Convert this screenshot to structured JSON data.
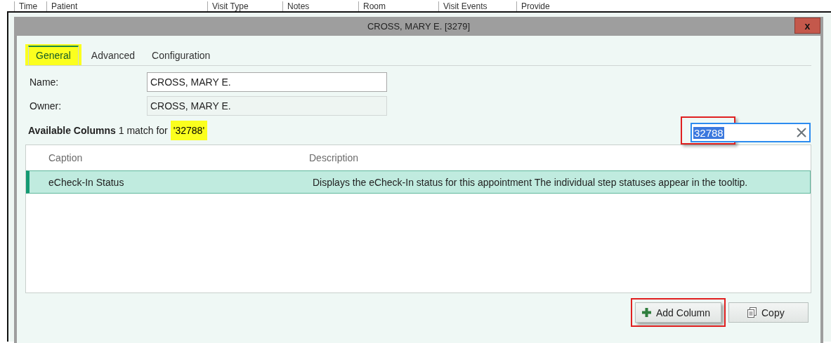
{
  "background_table": {
    "columns": [
      "Time",
      "Patient",
      "Visit Type",
      "Notes",
      "Room",
      "Visit Events",
      "Provide"
    ]
  },
  "dialog": {
    "title": "CROSS, MARY E. [3279]",
    "close_label": "x"
  },
  "tabs": [
    {
      "label": "General",
      "selected": true,
      "highlighted": true
    },
    {
      "label": "Advanced",
      "selected": false,
      "highlighted": false
    },
    {
      "label": "Configuration",
      "selected": false,
      "highlighted": false
    }
  ],
  "fields": [
    {
      "label": "Name:",
      "value": "CROSS, MARY E.",
      "disabled": false
    },
    {
      "label": "Owner:",
      "value": "CROSS, MARY E.",
      "disabled": true
    }
  ],
  "available": {
    "title": "Available Columns",
    "match_text": "1 match for",
    "query": "'32788'",
    "query_highlighted": true
  },
  "search": {
    "value": "32788",
    "highlighted": true
  },
  "grid": {
    "columns": [
      "Caption",
      "Description"
    ],
    "rows": [
      {
        "cells": [
          "eCheck-In Status",
          "Displays the eCheck-In status for this appointment The individual step statuses appear in the tooltip."
        ],
        "selected": true
      }
    ]
  },
  "buttons": [
    {
      "label": "Add Column",
      "kind": "add",
      "highlighted": true
    },
    {
      "label": "Copy",
      "kind": "copy",
      "highlighted": false
    }
  ]
}
